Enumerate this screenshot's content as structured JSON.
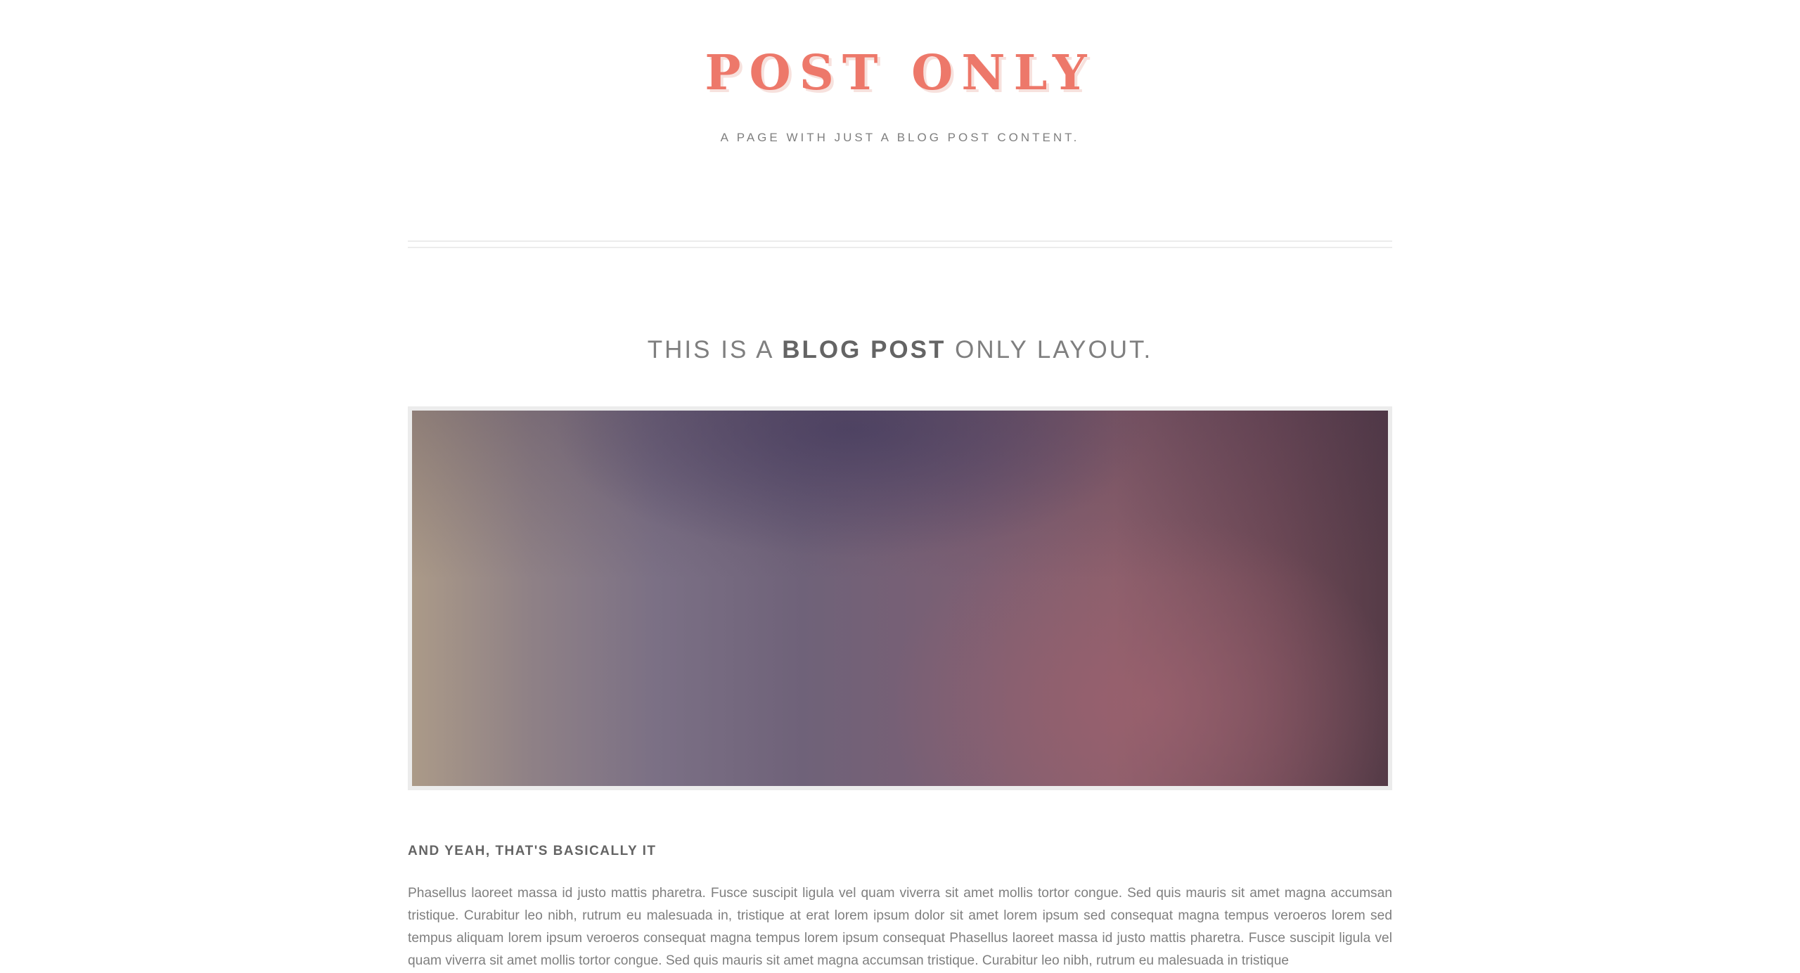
{
  "header": {
    "site_title": "POST ONLY",
    "tagline": "A PAGE WITH JUST A BLOG POST CONTENT."
  },
  "post": {
    "title_prefix": "THIS IS A",
    "title_emphasis": "BLOG POST",
    "title_suffix": "ONLY LAYOUT.",
    "section_heading": "AND YEAH, THAT'S BASICALLY IT",
    "body": "Phasellus laoreet massa id justo mattis pharetra. Fusce suscipit ligula vel quam viverra sit amet mollis tortor congue. Sed quis mauris sit amet magna accumsan tristique. Curabitur leo nibh, rutrum eu malesuada in, tristique at erat lorem ipsum dolor sit amet lorem ipsum sed consequat magna tempus veroeros lorem sed tempus aliquam lorem ipsum veroeros consequat magna tempus lorem ipsum consequat Phasellus laoreet massa id justo mattis pharetra. Fusce suscipit ligula vel quam viverra sit amet mollis tortor congue. Sed quis mauris sit amet magna accumsan tristique. Curabitur leo nibh, rutrum eu malesuada in tristique"
  },
  "colors": {
    "accent": "#ed786a",
    "text": "#7f7f7f",
    "heading": "#646464",
    "divider": "#ececec"
  }
}
